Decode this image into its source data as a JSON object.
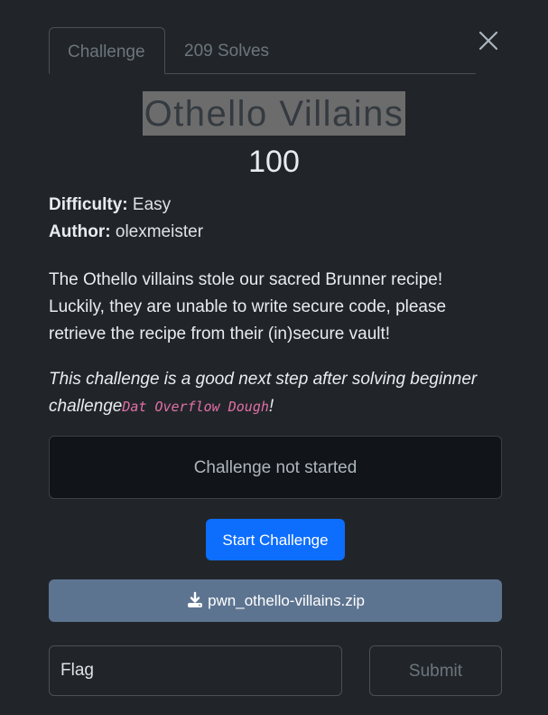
{
  "tabs": [
    {
      "label": "Challenge",
      "active": true
    },
    {
      "label": "209 Solves",
      "active": false
    }
  ],
  "close_icon": "close-icon",
  "challenge": {
    "title": "Othello Villains",
    "points": "100",
    "difficulty_label": "Difficulty:",
    "difficulty": "Easy",
    "author_label": "Author:",
    "author": "olexmeister",
    "description": "The Othello villains stole our sacred Brunner recipe! Luckily, they are unable to write secure code, please retrieve the recipe from their (in)secure vault!",
    "note_prefix": "This challenge is a good next step after solving beginner challenge",
    "note_code": "Dat Overflow Dough",
    "note_suffix": "!"
  },
  "status": {
    "text": "Challenge not started"
  },
  "actions": {
    "start_label": "Start Challenge",
    "download_label": "pwn_othello-villains.zip",
    "download_icon": "download-icon"
  },
  "flag_form": {
    "placeholder": "Flag",
    "value": "",
    "submit_label": "Submit"
  },
  "colors": {
    "background": "#212529",
    "primary": "#0d6efd",
    "download": "#5d7491",
    "code": "#e36fa8"
  }
}
